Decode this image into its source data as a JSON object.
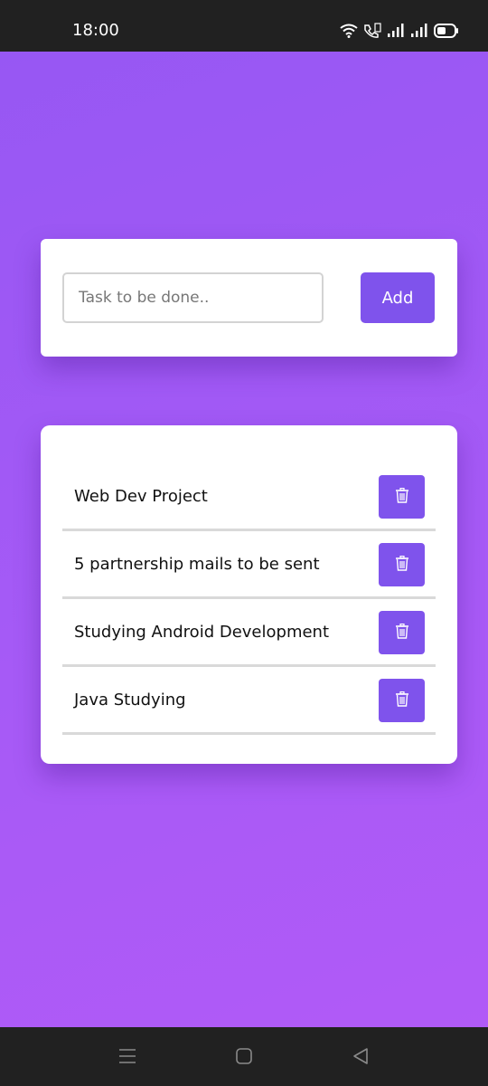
{
  "status_bar": {
    "time": "18:00",
    "icons": [
      "wifi-icon",
      "volte-icon",
      "signal-icon",
      "signal-icon",
      "battery-icon"
    ]
  },
  "input_card": {
    "placeholder": "Task to be done..",
    "value": "",
    "add_label": "Add"
  },
  "tasks": [
    {
      "label": "Web Dev Project",
      "action_icon": "trash-icon"
    },
    {
      "label": "5 partnership mails to be sent",
      "action_icon": "trash-icon"
    },
    {
      "label": "Studying Android Development",
      "action_icon": "trash-icon"
    },
    {
      "label": "Java Studying",
      "action_icon": "trash-icon"
    }
  ],
  "nav_bar": {
    "icons": [
      "recents-icon",
      "home-icon",
      "back-icon"
    ]
  },
  "colors": {
    "accent": "#7f53ec",
    "background_gradient_start": "#9757f3",
    "background_gradient_end": "#b15af7",
    "system_bar": "#212121"
  }
}
